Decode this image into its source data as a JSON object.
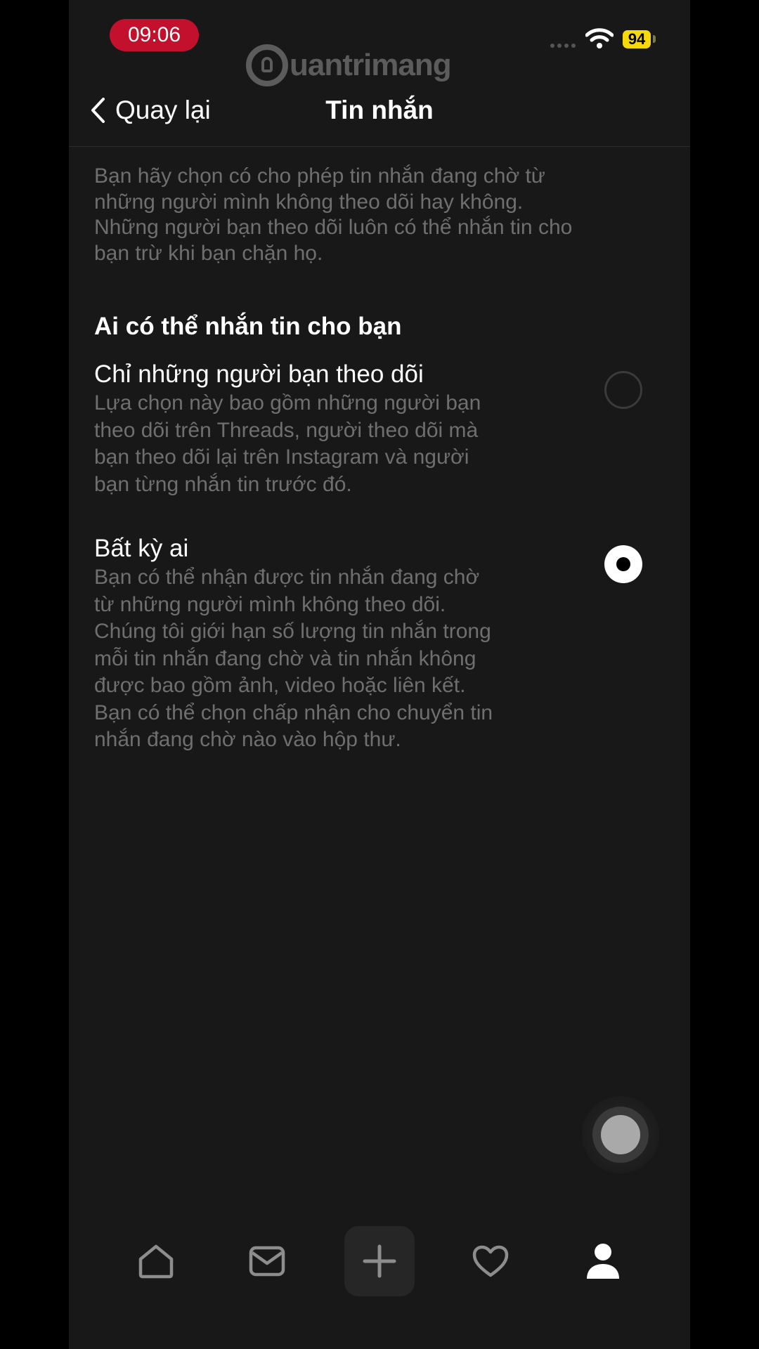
{
  "status_bar": {
    "time": "09:06",
    "battery": "94"
  },
  "watermark": {
    "text": "uantrimang"
  },
  "header": {
    "back_label": "Quay lại",
    "title": "Tin nhắn"
  },
  "intro_text": "Bạn hãy chọn có cho phép tin nhắn đang chờ từ những người mình không theo dõi hay không. Những người bạn theo dõi luôn có thể nhắn tin cho bạn trừ khi bạn chặn họ.",
  "section": {
    "title": "Ai có thể nhắn tin cho bạn",
    "options": [
      {
        "label": "Chỉ những người bạn theo dõi",
        "description": "Lựa chọn này bao gồm những người bạn theo dõi trên Threads, người theo dõi mà bạn theo dõi lại trên Instagram và người bạn từng nhắn tin trước đó.",
        "selected": false
      },
      {
        "label": "Bất kỳ ai",
        "description": "Bạn có thể nhận được tin nhắn đang chờ từ những người mình không theo dõi. Chúng tôi giới hạn số lượng tin nhắn trong mỗi tin nhắn đang chờ và tin nhắn không được bao gồm ảnh, video hoặc liên kết. Bạn có thể chọn chấp nhận cho chuyển tin nhắn đang chờ nào vào hộp thư.",
        "selected": true
      }
    ]
  },
  "tab_bar": {
    "icons": [
      "home-icon",
      "inbox-icon",
      "plus-icon",
      "heart-icon",
      "profile-icon"
    ],
    "active": "profile-icon"
  },
  "colors": {
    "background": "#181818",
    "time_pill": "#c3102d",
    "battery": "#f5d90a",
    "muted_text": "#6f6f6f"
  }
}
